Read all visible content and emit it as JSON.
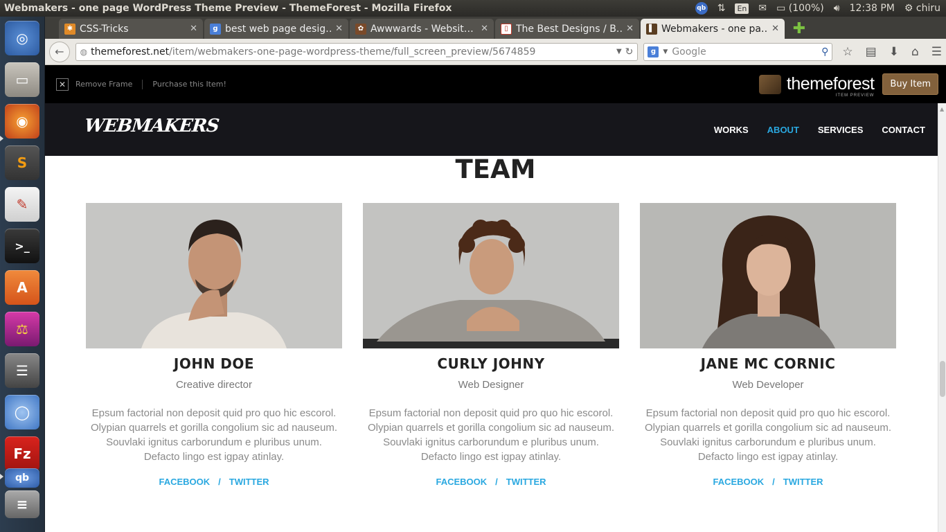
{
  "window": {
    "title": "Webmakers - one page WordPress Theme Preview - ThemeForest - Mozilla Firefox"
  },
  "tray": {
    "lang": "En",
    "battery": "(100%)",
    "time": "12:38 PM",
    "user": "chiru"
  },
  "tabs": [
    {
      "label": "CSS-Tricks",
      "favicon": "asterisk-favicon",
      "color": "#e08a28"
    },
    {
      "label": "best web page desig…",
      "favicon": "google-favicon",
      "color": "#4a7fd8"
    },
    {
      "label": "Awwwards - Websit…",
      "favicon": "awwwards-favicon",
      "color": "#7a4a2a"
    },
    {
      "label": "The Best Designs / B…",
      "favicon": "bestdesigns-favicon",
      "color": "#c0392b"
    },
    {
      "label": "Webmakers - one pa…",
      "favicon": "themeforest-favicon",
      "color": "#5a3e22",
      "active": true
    }
  ],
  "navbar": {
    "url_host": "themeforest.net",
    "url_path": "/item/webmakers-one-page-wordpress-theme/full_screen_preview/5674859",
    "search_placeholder": "Google"
  },
  "tf_bar": {
    "remove_frame": "Remove Frame",
    "purchase": "Purchase this Item!",
    "logo": "themeforest",
    "logo_sub": "ITEM PREVIEW",
    "buy": "Buy Item"
  },
  "site": {
    "logo": "WEBMAKERS",
    "nav": [
      "WORKS",
      "ABOUT",
      "SERVICES",
      "CONTACT"
    ],
    "active_nav": "ABOUT",
    "accent": "#2aa8e0"
  },
  "team": {
    "title": "TEAM",
    "members": [
      {
        "name": "JOHN DOE",
        "role": "Creative director",
        "bio": "Epsum factorial non deposit quid pro quo hic escorol. Olypian quarrels et gorilla congolium sic ad nauseum. Souvlaki ignitus carborundum e pluribus unum. Defacto lingo est igpay atinlay.",
        "facebook": "FACEBOOK",
        "sep": "/",
        "twitter": "TWITTER"
      },
      {
        "name": "CURLY JOHNY",
        "role": "Web Designer",
        "bio": "Epsum factorial non deposit quid pro quo hic escorol. Olypian quarrels et gorilla congolium sic ad nauseum. Souvlaki ignitus carborundum e pluribus unum. Defacto lingo est igpay atinlay.",
        "facebook": "FACEBOOK",
        "sep": "/",
        "twitter": "TWITTER"
      },
      {
        "name": "JANE MC CORNIC",
        "role": "Web Developer",
        "bio": "Epsum factorial non deposit quid pro quo hic escorol. Olypian quarrels et gorilla congolium sic ad nauseum. Souvlaki ignitus carborundum e pluribus unum. Defacto lingo est igpay atinlay.",
        "facebook": "FACEBOOK",
        "sep": "/",
        "twitter": "TWITTER"
      }
    ]
  }
}
